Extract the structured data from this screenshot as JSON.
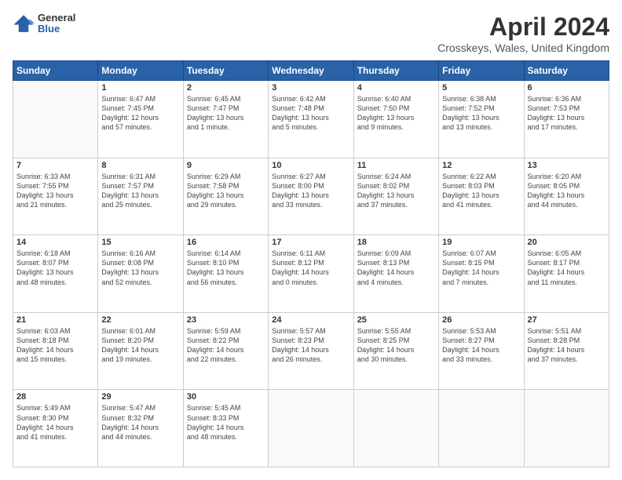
{
  "logo": {
    "general": "General",
    "blue": "Blue"
  },
  "title": {
    "month": "April 2024",
    "location": "Crosskeys, Wales, United Kingdom"
  },
  "weekdays": [
    "Sunday",
    "Monday",
    "Tuesday",
    "Wednesday",
    "Thursday",
    "Friday",
    "Saturday"
  ],
  "weeks": [
    [
      {
        "day": "",
        "text": ""
      },
      {
        "day": "1",
        "text": "Sunrise: 6:47 AM\nSunset: 7:45 PM\nDaylight: 12 hours\nand 57 minutes."
      },
      {
        "day": "2",
        "text": "Sunrise: 6:45 AM\nSunset: 7:47 PM\nDaylight: 13 hours\nand 1 minute."
      },
      {
        "day": "3",
        "text": "Sunrise: 6:42 AM\nSunset: 7:48 PM\nDaylight: 13 hours\nand 5 minutes."
      },
      {
        "day": "4",
        "text": "Sunrise: 6:40 AM\nSunset: 7:50 PM\nDaylight: 13 hours\nand 9 minutes."
      },
      {
        "day": "5",
        "text": "Sunrise: 6:38 AM\nSunset: 7:52 PM\nDaylight: 13 hours\nand 13 minutes."
      },
      {
        "day": "6",
        "text": "Sunrise: 6:36 AM\nSunset: 7:53 PM\nDaylight: 13 hours\nand 17 minutes."
      }
    ],
    [
      {
        "day": "7",
        "text": "Sunrise: 6:33 AM\nSunset: 7:55 PM\nDaylight: 13 hours\nand 21 minutes."
      },
      {
        "day": "8",
        "text": "Sunrise: 6:31 AM\nSunset: 7:57 PM\nDaylight: 13 hours\nand 25 minutes."
      },
      {
        "day": "9",
        "text": "Sunrise: 6:29 AM\nSunset: 7:58 PM\nDaylight: 13 hours\nand 29 minutes."
      },
      {
        "day": "10",
        "text": "Sunrise: 6:27 AM\nSunset: 8:00 PM\nDaylight: 13 hours\nand 33 minutes."
      },
      {
        "day": "11",
        "text": "Sunrise: 6:24 AM\nSunset: 8:02 PM\nDaylight: 13 hours\nand 37 minutes."
      },
      {
        "day": "12",
        "text": "Sunrise: 6:22 AM\nSunset: 8:03 PM\nDaylight: 13 hours\nand 41 minutes."
      },
      {
        "day": "13",
        "text": "Sunrise: 6:20 AM\nSunset: 8:05 PM\nDaylight: 13 hours\nand 44 minutes."
      }
    ],
    [
      {
        "day": "14",
        "text": "Sunrise: 6:18 AM\nSunset: 8:07 PM\nDaylight: 13 hours\nand 48 minutes."
      },
      {
        "day": "15",
        "text": "Sunrise: 6:16 AM\nSunset: 8:08 PM\nDaylight: 13 hours\nand 52 minutes."
      },
      {
        "day": "16",
        "text": "Sunrise: 6:14 AM\nSunset: 8:10 PM\nDaylight: 13 hours\nand 56 minutes."
      },
      {
        "day": "17",
        "text": "Sunrise: 6:11 AM\nSunset: 8:12 PM\nDaylight: 14 hours\nand 0 minutes."
      },
      {
        "day": "18",
        "text": "Sunrise: 6:09 AM\nSunset: 8:13 PM\nDaylight: 14 hours\nand 4 minutes."
      },
      {
        "day": "19",
        "text": "Sunrise: 6:07 AM\nSunset: 8:15 PM\nDaylight: 14 hours\nand 7 minutes."
      },
      {
        "day": "20",
        "text": "Sunrise: 6:05 AM\nSunset: 8:17 PM\nDaylight: 14 hours\nand 11 minutes."
      }
    ],
    [
      {
        "day": "21",
        "text": "Sunrise: 6:03 AM\nSunset: 8:18 PM\nDaylight: 14 hours\nand 15 minutes."
      },
      {
        "day": "22",
        "text": "Sunrise: 6:01 AM\nSunset: 8:20 PM\nDaylight: 14 hours\nand 19 minutes."
      },
      {
        "day": "23",
        "text": "Sunrise: 5:59 AM\nSunset: 8:22 PM\nDaylight: 14 hours\nand 22 minutes."
      },
      {
        "day": "24",
        "text": "Sunrise: 5:57 AM\nSunset: 8:23 PM\nDaylight: 14 hours\nand 26 minutes."
      },
      {
        "day": "25",
        "text": "Sunrise: 5:55 AM\nSunset: 8:25 PM\nDaylight: 14 hours\nand 30 minutes."
      },
      {
        "day": "26",
        "text": "Sunrise: 5:53 AM\nSunset: 8:27 PM\nDaylight: 14 hours\nand 33 minutes."
      },
      {
        "day": "27",
        "text": "Sunrise: 5:51 AM\nSunset: 8:28 PM\nDaylight: 14 hours\nand 37 minutes."
      }
    ],
    [
      {
        "day": "28",
        "text": "Sunrise: 5:49 AM\nSunset: 8:30 PM\nDaylight: 14 hours\nand 41 minutes."
      },
      {
        "day": "29",
        "text": "Sunrise: 5:47 AM\nSunset: 8:32 PM\nDaylight: 14 hours\nand 44 minutes."
      },
      {
        "day": "30",
        "text": "Sunrise: 5:45 AM\nSunset: 8:33 PM\nDaylight: 14 hours\nand 48 minutes."
      },
      {
        "day": "",
        "text": ""
      },
      {
        "day": "",
        "text": ""
      },
      {
        "day": "",
        "text": ""
      },
      {
        "day": "",
        "text": ""
      }
    ]
  ]
}
